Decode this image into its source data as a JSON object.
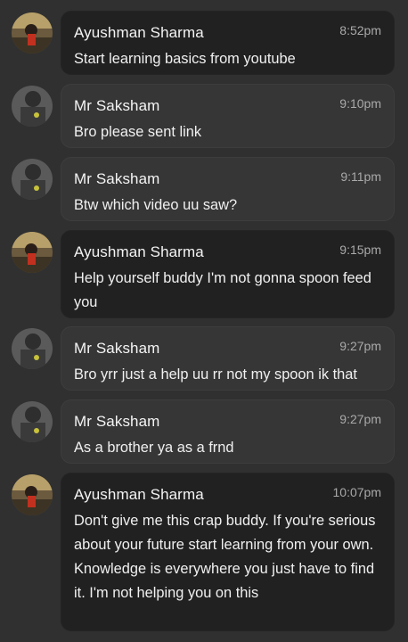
{
  "messages": [
    {
      "sender": "Ayushman Sharma",
      "time": "8:52pm",
      "text": "Start learning basics from youtube",
      "avatar": "ayushman-avatar"
    },
    {
      "sender": "Mr Saksham",
      "time": "9:10pm",
      "text": "Bro please sent link",
      "avatar": "saksham-avatar"
    },
    {
      "sender": "Mr Saksham",
      "time": "9:11pm",
      "text": "Btw which video uu saw?",
      "avatar": "saksham-avatar"
    },
    {
      "sender": "Ayushman Sharma",
      "time": "9:15pm",
      "text": "Help yourself buddy I'm not gonna spoon feed you",
      "avatar": "ayushman-avatar"
    },
    {
      "sender": "Mr Saksham",
      "time": "9:27pm",
      "text": "Bro yrr just a help uu rr not my spoon ik that",
      "avatar": "saksham-avatar"
    },
    {
      "sender": "Mr Saksham",
      "time": "9:27pm",
      "text": "As a brother ya as a frnd",
      "avatar": "saksham-avatar"
    },
    {
      "sender": "Ayushman Sharma",
      "time": "10:07pm",
      "text": "Don't give me this crap buddy. If you're serious about your future start learning from your own. Knowledge is everywhere you just have to find it. I'm not helping you on this",
      "avatar": "ayushman-avatar"
    }
  ],
  "colors": {
    "background": "#303030",
    "bubble_dark": "#212121",
    "bubble_mid": "#363636",
    "timestamp": "#a9a9a9"
  }
}
